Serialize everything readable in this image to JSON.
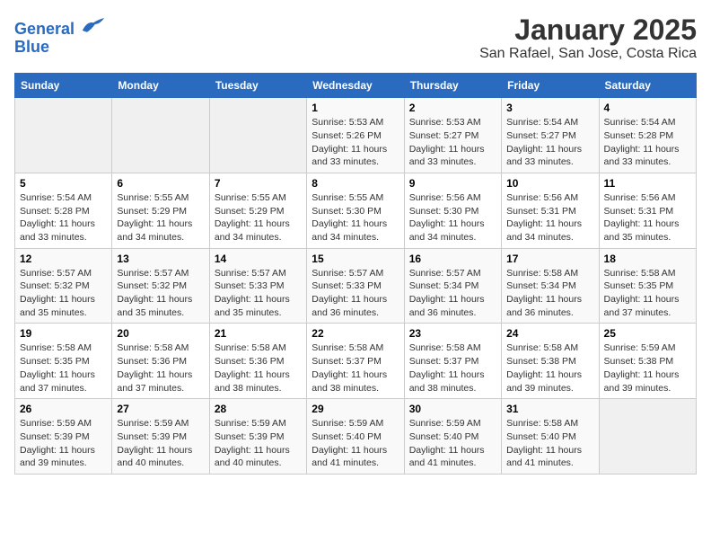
{
  "header": {
    "logo_line1": "General",
    "logo_line2": "Blue",
    "title": "January 2025",
    "subtitle": "San Rafael, San Jose, Costa Rica"
  },
  "weekdays": [
    "Sunday",
    "Monday",
    "Tuesday",
    "Wednesday",
    "Thursday",
    "Friday",
    "Saturday"
  ],
  "weeks": [
    [
      {
        "day": "",
        "info": ""
      },
      {
        "day": "",
        "info": ""
      },
      {
        "day": "",
        "info": ""
      },
      {
        "day": "1",
        "info": "Sunrise: 5:53 AM\nSunset: 5:26 PM\nDaylight: 11 hours\nand 33 minutes."
      },
      {
        "day": "2",
        "info": "Sunrise: 5:53 AM\nSunset: 5:27 PM\nDaylight: 11 hours\nand 33 minutes."
      },
      {
        "day": "3",
        "info": "Sunrise: 5:54 AM\nSunset: 5:27 PM\nDaylight: 11 hours\nand 33 minutes."
      },
      {
        "day": "4",
        "info": "Sunrise: 5:54 AM\nSunset: 5:28 PM\nDaylight: 11 hours\nand 33 minutes."
      }
    ],
    [
      {
        "day": "5",
        "info": "Sunrise: 5:54 AM\nSunset: 5:28 PM\nDaylight: 11 hours\nand 33 minutes."
      },
      {
        "day": "6",
        "info": "Sunrise: 5:55 AM\nSunset: 5:29 PM\nDaylight: 11 hours\nand 34 minutes."
      },
      {
        "day": "7",
        "info": "Sunrise: 5:55 AM\nSunset: 5:29 PM\nDaylight: 11 hours\nand 34 minutes."
      },
      {
        "day": "8",
        "info": "Sunrise: 5:55 AM\nSunset: 5:30 PM\nDaylight: 11 hours\nand 34 minutes."
      },
      {
        "day": "9",
        "info": "Sunrise: 5:56 AM\nSunset: 5:30 PM\nDaylight: 11 hours\nand 34 minutes."
      },
      {
        "day": "10",
        "info": "Sunrise: 5:56 AM\nSunset: 5:31 PM\nDaylight: 11 hours\nand 34 minutes."
      },
      {
        "day": "11",
        "info": "Sunrise: 5:56 AM\nSunset: 5:31 PM\nDaylight: 11 hours\nand 35 minutes."
      }
    ],
    [
      {
        "day": "12",
        "info": "Sunrise: 5:57 AM\nSunset: 5:32 PM\nDaylight: 11 hours\nand 35 minutes."
      },
      {
        "day": "13",
        "info": "Sunrise: 5:57 AM\nSunset: 5:32 PM\nDaylight: 11 hours\nand 35 minutes."
      },
      {
        "day": "14",
        "info": "Sunrise: 5:57 AM\nSunset: 5:33 PM\nDaylight: 11 hours\nand 35 minutes."
      },
      {
        "day": "15",
        "info": "Sunrise: 5:57 AM\nSunset: 5:33 PM\nDaylight: 11 hours\nand 36 minutes."
      },
      {
        "day": "16",
        "info": "Sunrise: 5:57 AM\nSunset: 5:34 PM\nDaylight: 11 hours\nand 36 minutes."
      },
      {
        "day": "17",
        "info": "Sunrise: 5:58 AM\nSunset: 5:34 PM\nDaylight: 11 hours\nand 36 minutes."
      },
      {
        "day": "18",
        "info": "Sunrise: 5:58 AM\nSunset: 5:35 PM\nDaylight: 11 hours\nand 37 minutes."
      }
    ],
    [
      {
        "day": "19",
        "info": "Sunrise: 5:58 AM\nSunset: 5:35 PM\nDaylight: 11 hours\nand 37 minutes."
      },
      {
        "day": "20",
        "info": "Sunrise: 5:58 AM\nSunset: 5:36 PM\nDaylight: 11 hours\nand 37 minutes."
      },
      {
        "day": "21",
        "info": "Sunrise: 5:58 AM\nSunset: 5:36 PM\nDaylight: 11 hours\nand 38 minutes."
      },
      {
        "day": "22",
        "info": "Sunrise: 5:58 AM\nSunset: 5:37 PM\nDaylight: 11 hours\nand 38 minutes."
      },
      {
        "day": "23",
        "info": "Sunrise: 5:58 AM\nSunset: 5:37 PM\nDaylight: 11 hours\nand 38 minutes."
      },
      {
        "day": "24",
        "info": "Sunrise: 5:58 AM\nSunset: 5:38 PM\nDaylight: 11 hours\nand 39 minutes."
      },
      {
        "day": "25",
        "info": "Sunrise: 5:59 AM\nSunset: 5:38 PM\nDaylight: 11 hours\nand 39 minutes."
      }
    ],
    [
      {
        "day": "26",
        "info": "Sunrise: 5:59 AM\nSunset: 5:39 PM\nDaylight: 11 hours\nand 39 minutes."
      },
      {
        "day": "27",
        "info": "Sunrise: 5:59 AM\nSunset: 5:39 PM\nDaylight: 11 hours\nand 40 minutes."
      },
      {
        "day": "28",
        "info": "Sunrise: 5:59 AM\nSunset: 5:39 PM\nDaylight: 11 hours\nand 40 minutes."
      },
      {
        "day": "29",
        "info": "Sunrise: 5:59 AM\nSunset: 5:40 PM\nDaylight: 11 hours\nand 41 minutes."
      },
      {
        "day": "30",
        "info": "Sunrise: 5:59 AM\nSunset: 5:40 PM\nDaylight: 11 hours\nand 41 minutes."
      },
      {
        "day": "31",
        "info": "Sunrise: 5:58 AM\nSunset: 5:40 PM\nDaylight: 11 hours\nand 41 minutes."
      },
      {
        "day": "",
        "info": ""
      }
    ]
  ]
}
